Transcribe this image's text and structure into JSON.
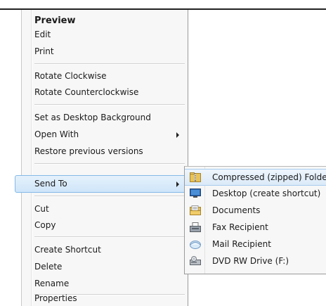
{
  "context_menu": {
    "items": [
      {
        "label": "Preview",
        "bold": true
      },
      {
        "label": "Edit"
      },
      {
        "label": "Print"
      },
      {
        "label": "Rotate Clockwise"
      },
      {
        "label": "Rotate Counterclockwise"
      },
      {
        "label": "Set as Desktop Background"
      },
      {
        "label": "Open With",
        "has_submenu": true
      },
      {
        "label": "Restore previous versions"
      },
      {
        "label": "Send To",
        "has_submenu": true,
        "highlighted": true
      },
      {
        "label": "Cut"
      },
      {
        "label": "Copy"
      },
      {
        "label": "Create Shortcut"
      },
      {
        "label": "Delete"
      },
      {
        "label": "Rename"
      },
      {
        "label": "Properties"
      }
    ]
  },
  "send_to_submenu": {
    "items": [
      {
        "label": "Compressed (zipped) Folde",
        "icon": "zip-folder-icon",
        "active": true
      },
      {
        "label": "Desktop (create shortcut)",
        "icon": "desktop-icon"
      },
      {
        "label": "Documents",
        "icon": "documents-icon"
      },
      {
        "label": "Fax Recipient",
        "icon": "fax-icon"
      },
      {
        "label": "Mail Recipient",
        "icon": "mail-icon"
      },
      {
        "label": "DVD RW Drive (F:)",
        "icon": "dvd-drive-icon"
      }
    ]
  },
  "colors": {
    "highlight_border": "#84b9e6",
    "highlight_fill": "#cfe5f9",
    "menu_background": "#f7f7f7"
  }
}
